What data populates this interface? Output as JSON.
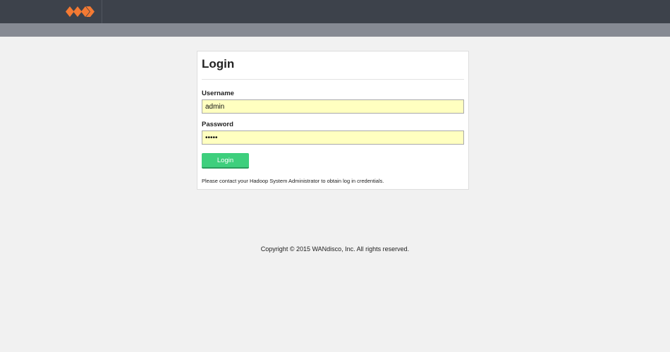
{
  "header": {
    "logo_icon": "wandisco-logo-icon",
    "brand_color": "#f47a33"
  },
  "login": {
    "title": "Login",
    "username_label": "Username",
    "username_value": "admin",
    "password_label": "Password",
    "password_value": "•••••",
    "button_label": "Login",
    "help_text": "Please contact your Hadoop System Administrator to obtain log in credentials."
  },
  "footer": {
    "copyright": "Copyright © 2015 WANdisco, Inc. All rights reserved."
  },
  "colors": {
    "topbar": "#3d424b",
    "subbar": "#868a93",
    "button": "#3ecf7d",
    "input_fill": "#ffffc0"
  }
}
